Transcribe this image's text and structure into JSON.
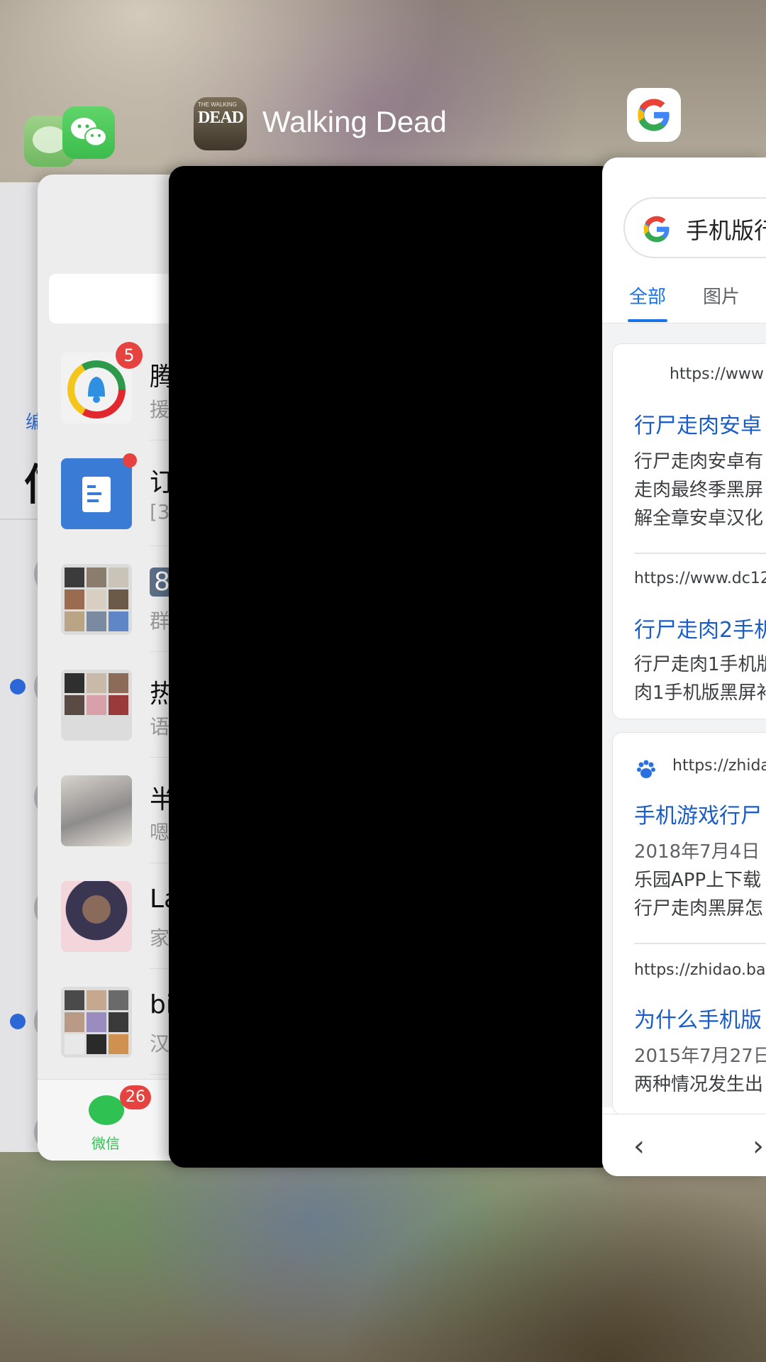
{
  "app_switcher": {
    "messages": {
      "back_link": "编",
      "title_char": "信"
    },
    "wechat": {
      "chats": [
        {
          "name": "腾",
          "preview": "援",
          "badge": "5"
        },
        {
          "name": "订",
          "preview": "[3",
          "dot": true
        },
        {
          "name": "8",
          "preview": "群"
        },
        {
          "name": "热",
          "preview": "语"
        },
        {
          "name": "半",
          "preview": "嗯"
        },
        {
          "name": "La",
          "preview": "家"
        },
        {
          "name": "bi",
          "preview": "汉"
        }
      ],
      "tab_label": "微信",
      "tab_badge": "26"
    },
    "walking_dead": {
      "app_name": "Walking Dead",
      "icon_text": "DEAD",
      "icon_small_text": "THE WALKING"
    },
    "google": {
      "search_query": "手机版行",
      "tabs": [
        "全部",
        "图片"
      ],
      "results": [
        {
          "url": "https://www",
          "title": "行尸走肉安卓",
          "snippet": [
            "行尸走肉安卓有",
            "走肉最终季黑屏",
            "解全章安卓汉化"
          ]
        },
        {
          "url": "https://www.dc12",
          "title": "行尸走肉2手机",
          "snippet": [
            "行尸走肉1手机版",
            "肉1手机版黑屏补"
          ]
        },
        {
          "url": "https://zhida",
          "title": "手机游戏行尸",
          "date": "2018年7月4日",
          "snippet": [
            "乐园APP上下载",
            "行尸走肉黑屏怎"
          ]
        },
        {
          "url": "https://zhidao.ba",
          "title": "为什么手机版",
          "date": "2015年7月27日",
          "snippet": [
            "两种情况发生出"
          ]
        }
      ],
      "nav_back": "‹",
      "nav_forward": "›"
    }
  },
  "colors": {
    "wechat_green": "#30c153",
    "badge_red": "#e64340",
    "google_link_blue": "#1a5dc6",
    "google_tab_blue": "#1a73e8"
  }
}
